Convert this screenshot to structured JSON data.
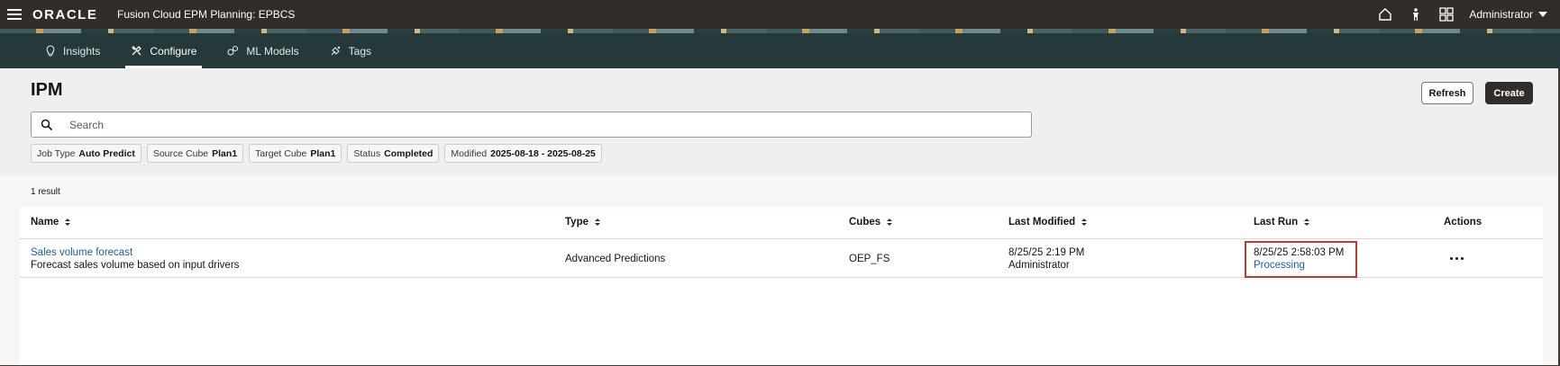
{
  "header": {
    "brand": "ORACLE",
    "app_title": "Fusion Cloud EPM Planning: EPBCS",
    "user": "Administrator",
    "icons": [
      "home-icon",
      "accessibility-icon",
      "grid-icon"
    ]
  },
  "tabs": [
    {
      "label": "Insights",
      "icon": "lightbulb-icon",
      "active": false
    },
    {
      "label": "Configure",
      "icon": "tools-icon",
      "active": true
    },
    {
      "label": "ML Models",
      "icon": "ml-models-icon",
      "active": false
    },
    {
      "label": "Tags",
      "icon": "tags-icon",
      "active": false
    }
  ],
  "page": {
    "title": "IPM",
    "refresh_label": "Refresh",
    "create_label": "Create",
    "search_placeholder": "Search"
  },
  "filters": [
    {
      "key": "Job Type",
      "value": "Auto Predict"
    },
    {
      "key": "Source Cube",
      "value": "Plan1"
    },
    {
      "key": "Target Cube",
      "value": "Plan1"
    },
    {
      "key": "Status",
      "value": "Completed"
    },
    {
      "key": "Modified",
      "value": "2025-08-18 - 2025-08-25"
    }
  ],
  "results": {
    "count_label": "1 result",
    "columns": [
      "Name",
      "Type",
      "Cubes",
      "Last Modified",
      "Last Run",
      "Actions"
    ],
    "rows": [
      {
        "name": "Sales volume forecast",
        "description": "Forecast sales volume based on input drivers",
        "type": "Advanced Predictions",
        "cubes": "OEP_FS",
        "last_modified": "8/25/25 2:19 PM",
        "modified_by": "Administrator",
        "last_run": "8/25/25 2:58:03 PM",
        "run_status": "Processing"
      }
    ]
  },
  "colors": {
    "header_bg": "#312d2a",
    "tabs_bg": "#25393a",
    "link": "#1a5f9e",
    "highlight": "#c0392b"
  }
}
